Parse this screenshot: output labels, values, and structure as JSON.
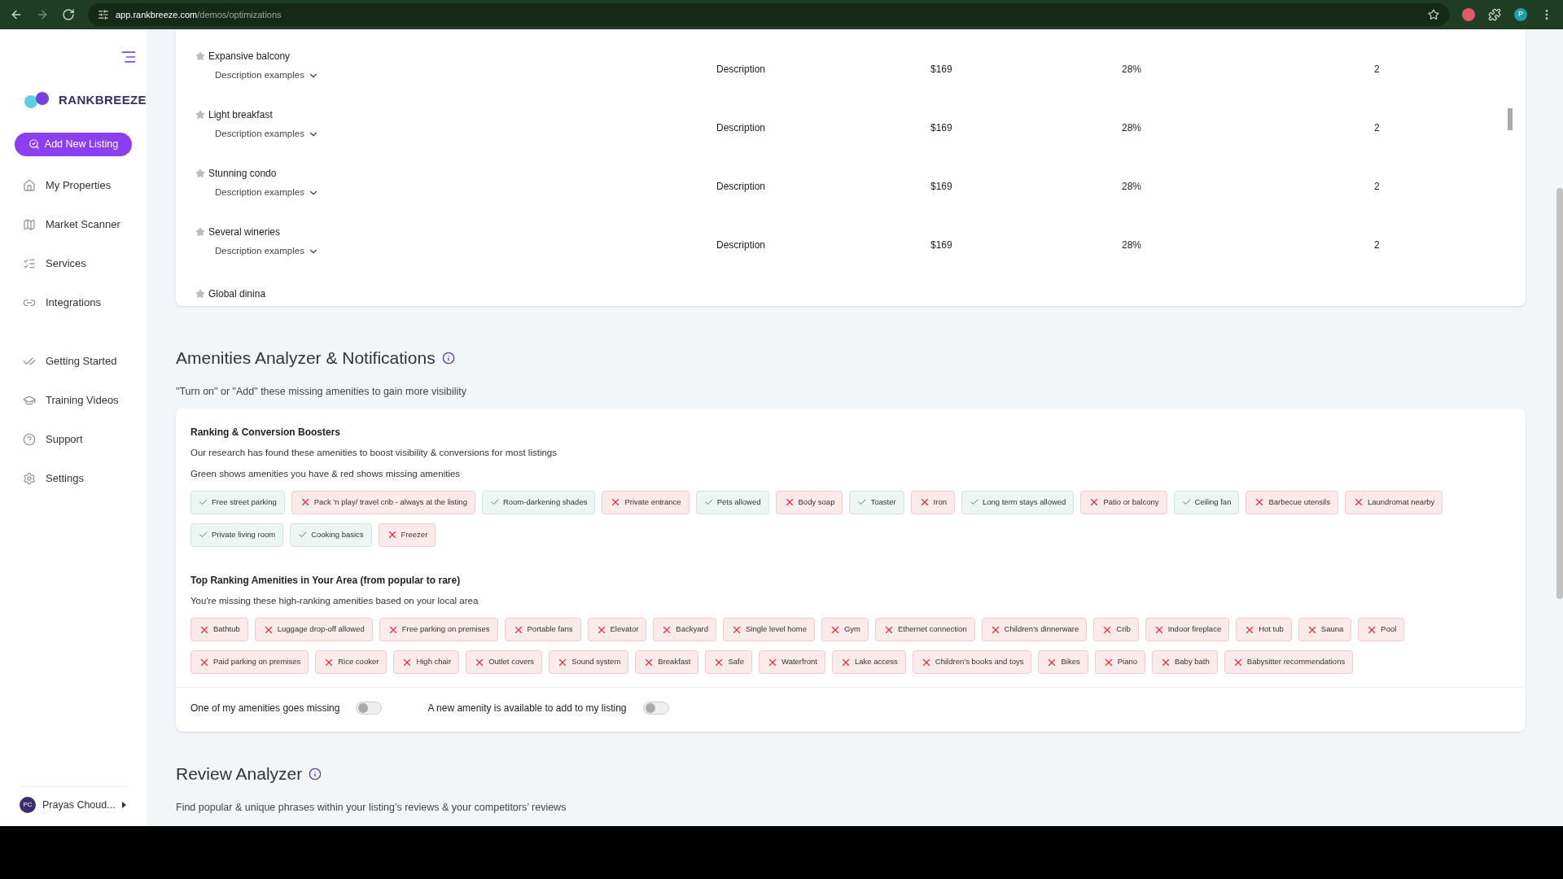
{
  "browser": {
    "url_host": "app.rankbreeze.com",
    "url_path": "/demos/optimizations",
    "profile_initial": "P"
  },
  "sidebar": {
    "logo_text": "RANKBREEZE",
    "add_button": "Add New Listing",
    "items": [
      {
        "label": "My Properties"
      },
      {
        "label": "Market Scanner"
      },
      {
        "label": "Services"
      },
      {
        "label": "Integrations"
      }
    ],
    "items2": [
      {
        "label": "Getting Started"
      },
      {
        "label": "Training Videos"
      },
      {
        "label": "Support"
      },
      {
        "label": "Settings"
      }
    ],
    "user": {
      "initials": "PC",
      "name": "Prayas Choud..."
    }
  },
  "table": {
    "rows": [
      {
        "keyword": "Expansive balcony",
        "examples": "Description examples",
        "type": "Description",
        "price": "$169",
        "percent": "28%",
        "count": "2"
      },
      {
        "keyword": "Light breakfast",
        "examples": "Description examples",
        "type": "Description",
        "price": "$169",
        "percent": "28%",
        "count": "2"
      },
      {
        "keyword": "Stunning condo",
        "examples": "Description examples",
        "type": "Description",
        "price": "$169",
        "percent": "28%",
        "count": "2"
      },
      {
        "keyword": "Several wineries",
        "examples": "Description examples",
        "type": "Description",
        "price": "$169",
        "percent": "28%",
        "count": "2"
      },
      {
        "keyword": "Global dinina"
      }
    ]
  },
  "amenities": {
    "title": "Amenities Analyzer & Notifications",
    "subtitle": "\"Turn on\" or \"Add\" these missing amenities to gain more visibility",
    "boosters": {
      "title": "Ranking & Conversion Boosters",
      "lines": [
        "Our research has found these amenities to boost visibility & conversions for most listings",
        "Green shows amenities you have & red shows missing amenities"
      ],
      "chips": [
        {
          "label": "Free street parking",
          "present": true
        },
        {
          "label": "Pack 'n play/ travel crib - always at the listing",
          "present": false
        },
        {
          "label": "Room-darkening shades",
          "present": true
        },
        {
          "label": "Private entrance",
          "present": false
        },
        {
          "label": "Pets allowed",
          "present": true
        },
        {
          "label": "Body soap",
          "present": false
        },
        {
          "label": "Toaster",
          "present": true
        },
        {
          "label": "Iron",
          "present": false
        },
        {
          "label": "Long term stays allowed",
          "present": true
        },
        {
          "label": "Patio or balcony",
          "present": false
        },
        {
          "label": "Ceiling fan",
          "present": true
        },
        {
          "label": "Barbecue utensils",
          "present": false
        },
        {
          "label": "Laundromat nearby",
          "present": false
        },
        {
          "label": "Private living room",
          "present": true
        },
        {
          "label": "Cooking basics",
          "present": true
        },
        {
          "label": "Freezer",
          "present": false
        }
      ]
    },
    "top": {
      "title": "Top Ranking Amenities in Your Area (from popular to rare)",
      "line": "You're missing these high-ranking amenities based on your local area",
      "chips": [
        {
          "label": "Bathtub",
          "present": false
        },
        {
          "label": "Luggage drop-off allowed",
          "present": false
        },
        {
          "label": "Free parking on premises",
          "present": false
        },
        {
          "label": "Portable fans",
          "present": false
        },
        {
          "label": "Elevator",
          "present": false
        },
        {
          "label": "Backyard",
          "present": false
        },
        {
          "label": "Single level home",
          "present": false
        },
        {
          "label": "Gym",
          "present": false
        },
        {
          "label": "Ethernet connection",
          "present": false
        },
        {
          "label": "Children’s dinnerware",
          "present": false
        },
        {
          "label": "Crib",
          "present": false
        },
        {
          "label": "Indoor fireplace",
          "present": false
        },
        {
          "label": "Hot tub",
          "present": false
        },
        {
          "label": "Sauna",
          "present": false
        },
        {
          "label": "Pool",
          "present": false
        },
        {
          "label": "Paid parking on premises",
          "present": false
        },
        {
          "label": "Rice cooker",
          "present": false
        },
        {
          "label": "High chair",
          "present": false
        },
        {
          "label": "Outlet covers",
          "present": false
        },
        {
          "label": "Sound system",
          "present": false
        },
        {
          "label": "Breakfast",
          "present": false
        },
        {
          "label": "Safe",
          "present": false
        },
        {
          "label": "Waterfront",
          "present": false
        },
        {
          "label": "Lake access",
          "present": false
        },
        {
          "label": "Children’s books and toys",
          "present": false
        },
        {
          "label": "Bikes",
          "present": false
        },
        {
          "label": "Piano",
          "present": false
        },
        {
          "label": "Baby bath",
          "present": false
        },
        {
          "label": "Babysitter recommendations",
          "present": false
        }
      ]
    },
    "toggles": [
      {
        "label": "One of my amenities goes missing",
        "on": false
      },
      {
        "label": "A new amenity is available to add to my listing",
        "on": false
      }
    ]
  },
  "review": {
    "title": "Review Analyzer",
    "subtitle": "Find popular & unique phrases within your listing’s reviews & your competitors’ reviews"
  }
}
